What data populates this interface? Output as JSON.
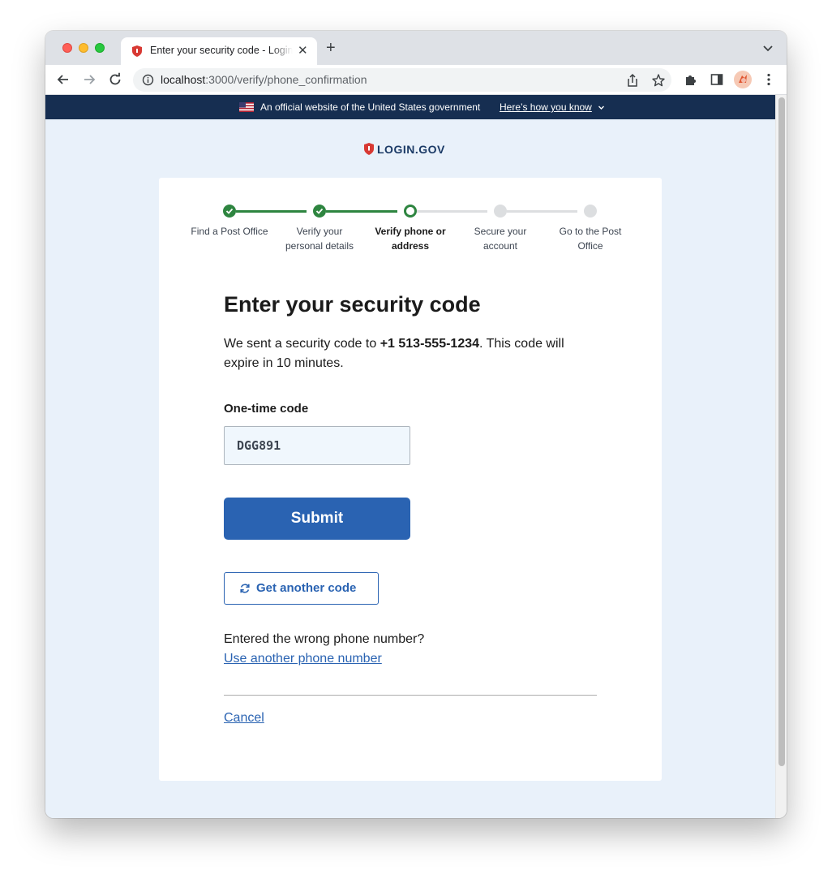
{
  "browser": {
    "tab_title": "Enter your security code - Login.gov",
    "url_host": "localhost",
    "url_path": ":3000/verify/phone_confirmation"
  },
  "gov_banner": {
    "text": "An official website of the United States government",
    "link": "Here’s how you know"
  },
  "logo": {
    "text": "LOGIN.GOV"
  },
  "steps": [
    {
      "label_line1": "Find a Post Office",
      "label_line2": "",
      "state": "done"
    },
    {
      "label_line1": "Verify your",
      "label_line2": "personal details",
      "state": "done"
    },
    {
      "label_line1": "Verify phone or",
      "label_line2": "address",
      "state": "current"
    },
    {
      "label_line1": "Secure your",
      "label_line2": "account",
      "state": "todo"
    },
    {
      "label_line1": "Go to the Post",
      "label_line2": "Office",
      "state": "todo"
    }
  ],
  "form": {
    "heading": "Enter your security code",
    "intro_prefix": "We sent a security code to ",
    "phone": "+1 513-555-1234",
    "intro_suffix": ". This code will expire in 10 minutes.",
    "field_label": "One-time code",
    "code_value": "DGG891",
    "submit_label": "Submit",
    "resend_label": "Get another code",
    "wrong_number_text": "Entered the wrong phone number?",
    "other_number_link": "Use another phone number",
    "cancel_link": "Cancel"
  },
  "colors": {
    "primary": "#2a63b2",
    "success": "#2e8540",
    "banner": "#162e51",
    "page_bg": "#e9f1fa"
  }
}
